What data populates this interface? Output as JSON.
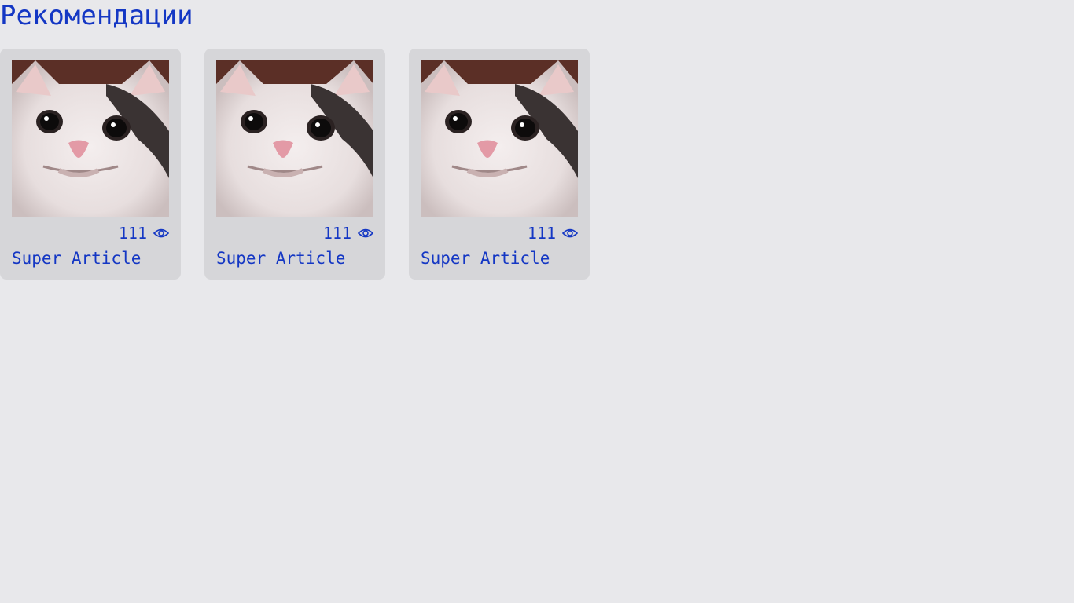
{
  "page": {
    "title": "Рекомендации"
  },
  "articles": [
    {
      "title": "Super Article",
      "views": "111",
      "image_icon": "cat-photo",
      "view_icon": "eye-icon"
    },
    {
      "title": "Super Article",
      "views": "111",
      "image_icon": "cat-photo",
      "view_icon": "eye-icon"
    },
    {
      "title": "Super Article",
      "views": "111",
      "image_icon": "cat-photo",
      "view_icon": "eye-icon"
    }
  ],
  "colors": {
    "accent": "#1437c4",
    "background": "#e8e8eb",
    "card": "#d6d6d9"
  }
}
